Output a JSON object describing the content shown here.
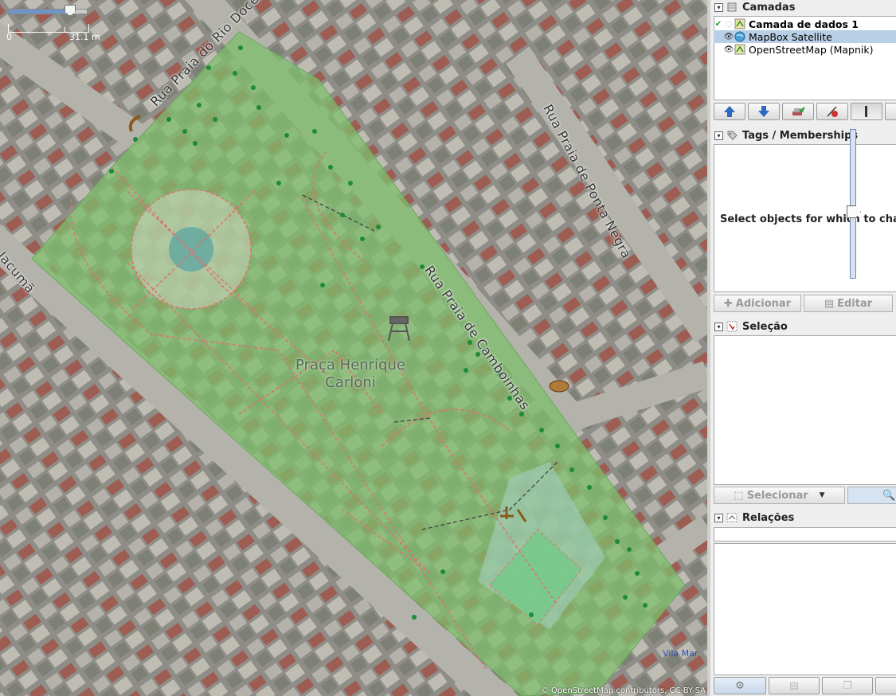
{
  "map": {
    "scale": {
      "min_label": "0",
      "max_label": "31.1 m",
      "zoom_level": 0.78
    },
    "streets": [
      {
        "id": "rio-doce",
        "label": "Rua Praia do Rio Doce"
      },
      {
        "id": "ponta-negra",
        "label": "Rua Praia de Ponta Negra"
      },
      {
        "id": "jacuma",
        "label": "Praia de Jacumã"
      },
      {
        "id": "camboinhas",
        "label": "Rua Praia de Camboinhas"
      }
    ],
    "park_name_line1": "Praça Henrique",
    "park_name_line2": "Carloni",
    "place_label": "Vila Mar",
    "attribution": "© OpenStreetMap contributors, CC-BY-SA"
  },
  "panels": {
    "layers": {
      "title": "Camadas",
      "items": [
        {
          "label": "Camada de dados 1",
          "state": "active",
          "visible": true,
          "icon": "data-layer-icon"
        },
        {
          "label": "MapBox Satellite",
          "state": "none",
          "visible": true,
          "selected": true,
          "icon": "globe-icon"
        },
        {
          "label": "OpenStreetMap (Mapnik)",
          "state": "none",
          "visible": true,
          "icon": "map-tiles-icon"
        }
      ],
      "opacity": 0.45
    },
    "tags": {
      "title": "Tags / Memberships",
      "empty_message": "Select objects for which to change tags.",
      "add_label": "Adicionar",
      "edit_label": "Editar"
    },
    "selection": {
      "title": "Seleção",
      "select_label": "Selecionar"
    },
    "relations": {
      "title": "Relações"
    }
  },
  "colors": {
    "park_fill": "#8fce7c",
    "path_dash": "#e07070",
    "tree": "#1e8a3a",
    "selected_row": "#b8cfe6"
  }
}
